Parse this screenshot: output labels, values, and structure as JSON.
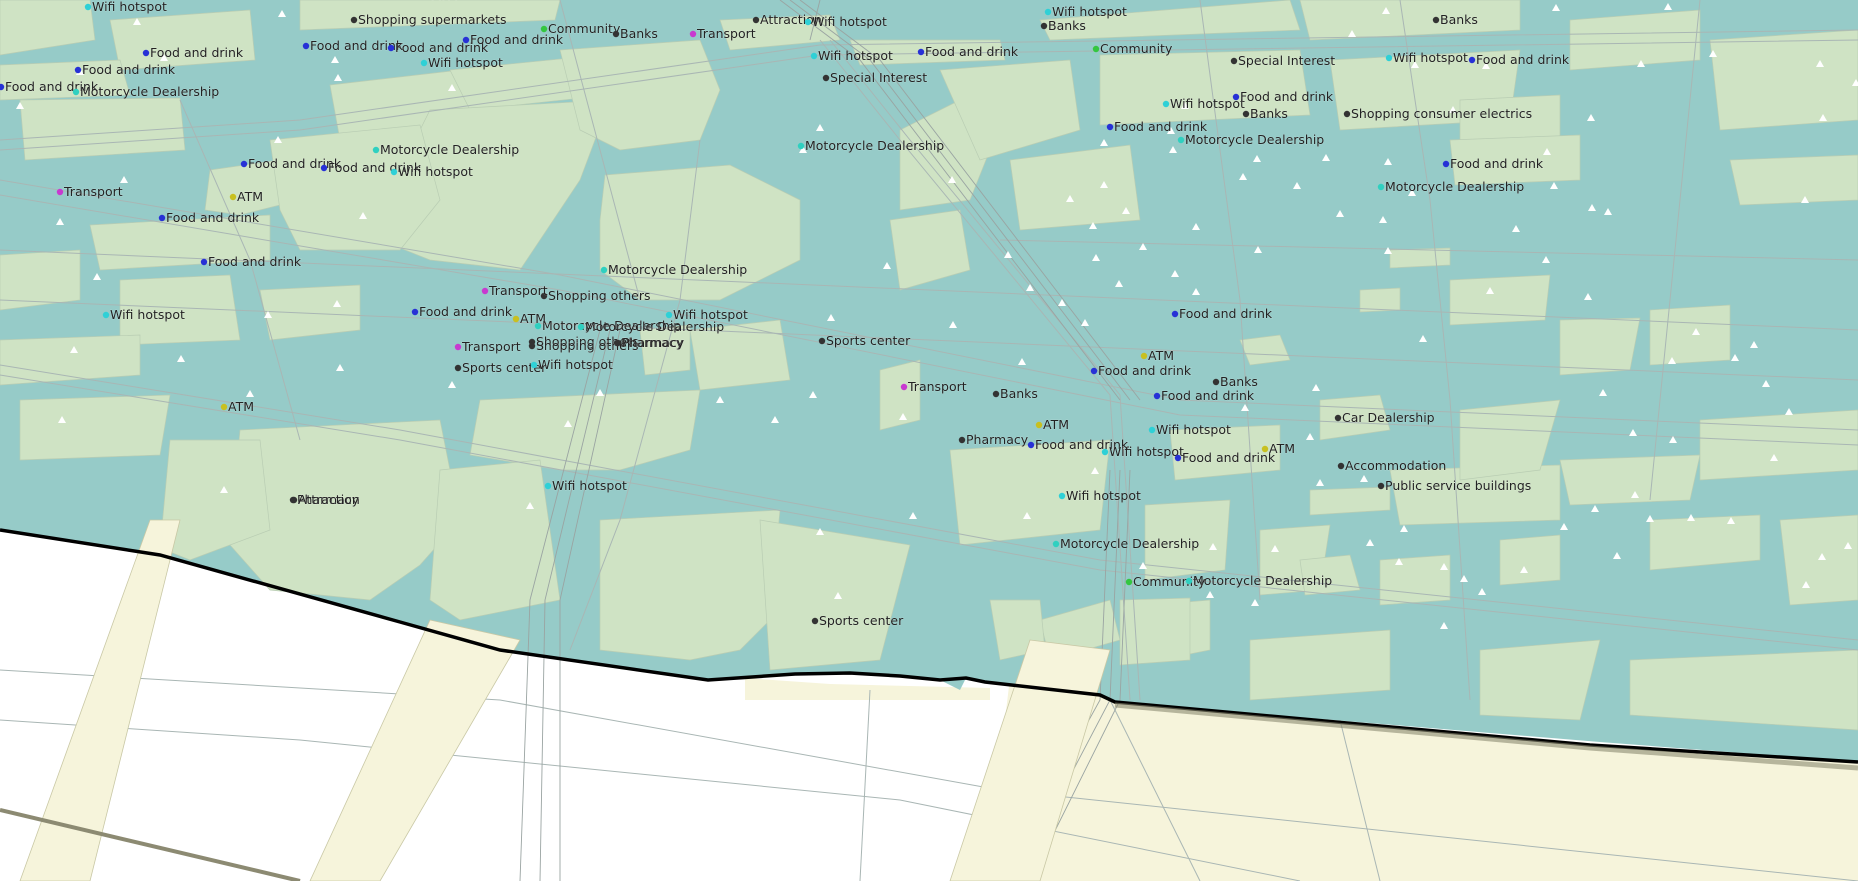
{
  "map": {
    "colors": {
      "urban": "#96cbc8",
      "block": "#cfe3c4",
      "river": "#ffffff",
      "south_bank": "#f6f4db",
      "road": "#a9b6b4",
      "rail": "#9aa4a2",
      "shore": "#000000"
    },
    "category_colors": {
      "Food and drink": "#2731d6",
      "Wifi hotspot": "#2fd0d6",
      "Motorcycle Dealership": "#2fd0c0",
      "Transport": "#c83ad0",
      "ATM": "#c8c020",
      "Banks": "#333333",
      "Community": "#34c640",
      "Shopping others": "#333333",
      "Sports center": "#333333",
      "Pharmacy": "#333333",
      "Attraction": "#333333",
      "Other": "#333333"
    },
    "pois": [
      {
        "label": "Wifi hotspot",
        "category": "Wifi hotspot"
      },
      {
        "label": "ATM",
        "category": "ATM"
      },
      {
        "label": "Shopping supermarkets",
        "category": "Other"
      },
      {
        "label": "Food and drink",
        "category": "Food and drink"
      },
      {
        "label": "Food and drink",
        "category": "Food and drink"
      },
      {
        "label": "Food and drink",
        "category": "Food and drink"
      },
      {
        "label": "Wifi hotspot",
        "category": "Wifi hotspot"
      },
      {
        "label": "Community",
        "category": "Community"
      },
      {
        "label": "Banks",
        "category": "Banks"
      },
      {
        "label": "Transport",
        "category": "Transport"
      },
      {
        "label": "Attraction",
        "category": "Attraction"
      },
      {
        "label": "Wifi hotspot",
        "category": "Wifi hotspot"
      },
      {
        "label": "Wifi hotspot",
        "category": "Wifi hotspot"
      },
      {
        "label": "Banks",
        "category": "Banks"
      },
      {
        "label": "Banks",
        "category": "Banks"
      },
      {
        "label": "Food and drink",
        "category": "Food and drink"
      },
      {
        "label": "Food and drink",
        "category": "Food and drink"
      },
      {
        "label": "Food and drink",
        "category": "Food and drink"
      },
      {
        "label": "Motorcycle Dealership",
        "category": "Motorcycle Dealership"
      },
      {
        "label": "Wifi hotspot",
        "category": "Wifi hotspot"
      },
      {
        "label": "Food and drink",
        "category": "Food and drink"
      },
      {
        "label": "Community",
        "category": "Community"
      },
      {
        "label": "Special Interest",
        "category": "Other"
      },
      {
        "label": "Wifi hotspot",
        "category": "Wifi hotspot"
      },
      {
        "label": "Food and drink",
        "category": "Food and drink"
      },
      {
        "label": "Special Interest",
        "category": "Other"
      },
      {
        "label": "Wifi hotspot",
        "category": "Wifi hotspot"
      },
      {
        "label": "Food and drink",
        "category": "Food and drink"
      },
      {
        "label": "Banks",
        "category": "Banks"
      },
      {
        "label": "Shopping consumer electrics",
        "category": "Other"
      },
      {
        "label": "Food and drink",
        "category": "Food and drink"
      },
      {
        "label": "Motorcycle Dealership",
        "category": "Motorcycle Dealership"
      },
      {
        "label": "Food and drink",
        "category": "Food and drink"
      },
      {
        "label": "Motorcycle Dealership",
        "category": "Motorcycle Dealership"
      },
      {
        "label": "Food and drink",
        "category": "Food and drink"
      },
      {
        "label": "Motorcycle Dealership",
        "category": "Motorcycle Dealership"
      },
      {
        "label": "Motorcycle Dealership",
        "category": "Motorcycle Dealership"
      },
      {
        "label": "Food and drink",
        "category": "Food and drink"
      },
      {
        "label": "Wifi hotspot",
        "category": "Wifi hotspot"
      },
      {
        "label": "Motorcycle Dealership",
        "category": "Motorcycle Dealership"
      },
      {
        "label": "Transport",
        "category": "Transport"
      },
      {
        "label": "ATM",
        "category": "ATM"
      },
      {
        "label": "Food and drink",
        "category": "Food and drink"
      },
      {
        "label": "Shopping others",
        "category": "Shopping others"
      },
      {
        "label": "Pharmacy",
        "category": "Pharmacy"
      },
      {
        "label": "Food and drink",
        "category": "Food and drink"
      },
      {
        "label": "Motorcycle Dealership",
        "category": "Motorcycle Dealership"
      },
      {
        "label": "Transport",
        "category": "Transport"
      },
      {
        "label": "Shopping others",
        "category": "Shopping others"
      },
      {
        "label": "Wifi hotspot",
        "category": "Wifi hotspot"
      },
      {
        "label": "Food and drink",
        "category": "Food and drink"
      },
      {
        "label": "ATM",
        "category": "ATM"
      },
      {
        "label": "Motorcycle Dealership",
        "category": "Motorcycle Dealership"
      },
      {
        "label": "Transport",
        "category": "Transport"
      },
      {
        "label": "Shopping others",
        "category": "Shopping others"
      },
      {
        "label": "Pharmacy",
        "category": "Pharmacy"
      },
      {
        "label": "Sports center",
        "category": "Sports center"
      },
      {
        "label": "Wifi hotspot",
        "category": "Wifi hotspot"
      },
      {
        "label": "Wifi hotspot",
        "category": "Wifi hotspot"
      },
      {
        "label": "Pharmacy",
        "category": "Pharmacy"
      },
      {
        "label": "Food and drink",
        "category": "Food and drink"
      },
      {
        "label": "Sports center",
        "category": "Sports center"
      },
      {
        "label": "ATM",
        "category": "ATM"
      },
      {
        "label": "Food and drink",
        "category": "Food and drink"
      },
      {
        "label": "Transport",
        "category": "Transport"
      },
      {
        "label": "Banks",
        "category": "Banks"
      },
      {
        "label": "Food and drink",
        "category": "Food and drink"
      },
      {
        "label": "Banks",
        "category": "Banks"
      },
      {
        "label": "Car Dealership",
        "category": "Other"
      },
      {
        "label": "ATM",
        "category": "ATM"
      },
      {
        "label": "ATM",
        "category": "ATM"
      },
      {
        "label": "Wifi hotspot",
        "category": "Wifi hotspot"
      },
      {
        "label": "Pharmacy",
        "category": "Pharmacy"
      },
      {
        "label": "Food and drink",
        "category": "Food and drink"
      },
      {
        "label": "Wifi hotspot",
        "category": "Wifi hotspot"
      },
      {
        "label": "Food and drink",
        "category": "Food and drink"
      },
      {
        "label": "ATM",
        "category": "ATM"
      },
      {
        "label": "Accommodation",
        "category": "Other"
      },
      {
        "label": "Public service buildings",
        "category": "Other"
      },
      {
        "label": "Wifi hotspot",
        "category": "Wifi hotspot"
      },
      {
        "label": "Attraction",
        "category": "Attraction"
      },
      {
        "label": "Wifi hotspot",
        "category": "Wifi hotspot"
      },
      {
        "label": "Motorcycle Dealership",
        "category": "Motorcycle Dealership"
      },
      {
        "label": "Community",
        "category": "Community"
      },
      {
        "label": "Motorcycle Dealership",
        "category": "Motorcycle Dealership"
      },
      {
        "label": "Sports center",
        "category": "Sports center"
      }
    ]
  }
}
